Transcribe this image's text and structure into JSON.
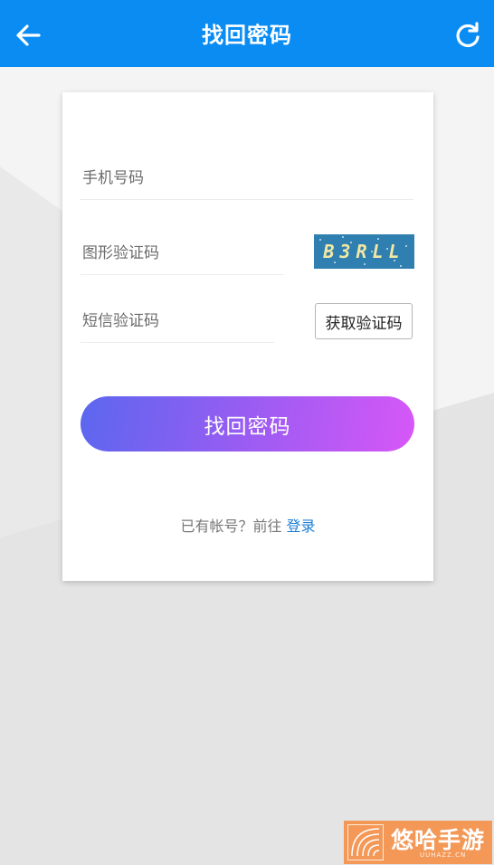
{
  "header": {
    "title": "找回密码",
    "back_icon": "arrow-left-icon",
    "refresh_icon": "refresh-icon",
    "bg_color": "#0b8cf3"
  },
  "form": {
    "phone_placeholder": "手机号码",
    "captcha_placeholder": "图形验证码",
    "captcha_text": "B3RLL",
    "sms_placeholder": "短信验证码",
    "sms_button_label": "获取验证码",
    "submit_label": "找回密码"
  },
  "footer": {
    "prompt": "已有帐号？前往 ",
    "login_link": "登录"
  },
  "watermark": {
    "brand": "悠哈手游",
    "site": "UUHAZZ.CN"
  },
  "colors": {
    "accent": "#0b8cf3",
    "gradient_start": "#5b67ef",
    "gradient_end": "#d757f7",
    "link": "#1e7fd6"
  }
}
